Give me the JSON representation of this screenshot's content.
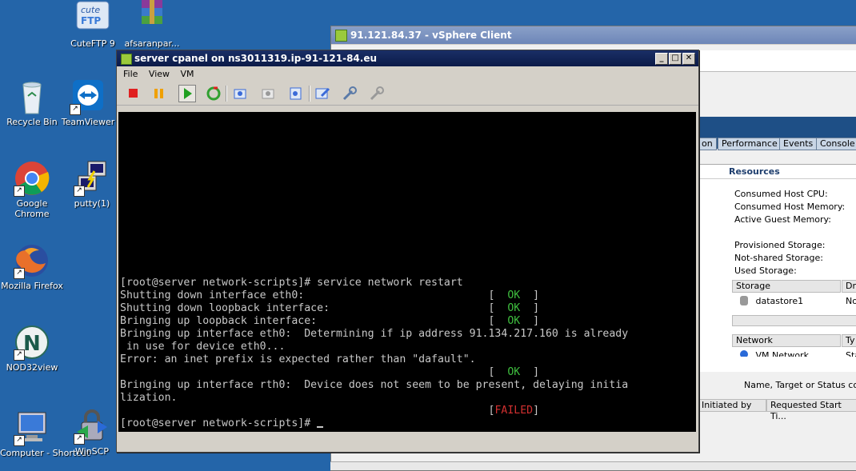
{
  "desktop": {
    "icons": [
      {
        "label": "CuteFTP 9",
        "icon": "cuteftp-icon"
      },
      {
        "label": "afsaranpar...",
        "icon": "winrar-archive-icon"
      },
      {
        "label": "Recycle Bin",
        "icon": "recycle-bin-icon"
      },
      {
        "label": "TeamViewer",
        "icon": "teamviewer-icon"
      },
      {
        "label": "Google Chrome",
        "icon": "chrome-icon"
      },
      {
        "label": "putty(1)",
        "icon": "putty-icon"
      },
      {
        "label": "Mozilla Firefox",
        "icon": "firefox-icon"
      },
      {
        "label": "NOD32view",
        "icon": "nod32-icon"
      },
      {
        "label": "Computer - Shortcut",
        "icon": "computer-icon"
      },
      {
        "label": "WinSCP",
        "icon": "winscp-icon"
      }
    ]
  },
  "vsphere": {
    "title": "91.121.84.37 - vSphere Client",
    "tabs": [
      "on",
      "Performance",
      "Events",
      "Console"
    ],
    "resources_title": "Resources",
    "resource_labels": [
      "Consumed Host CPU:",
      "Consumed Host Memory:",
      "Active Guest Memory:",
      "Provisioned Storage:",
      "Not-shared Storage:",
      "Used Storage:"
    ],
    "storage_header": "Storage",
    "storage_col2": "Dri",
    "datastore": "datastore1",
    "datastore_col2": "No",
    "network_header": "Network",
    "network_col2": "Ty",
    "network_item": "VM Network",
    "network_item_col2": "Sta",
    "tasks_filter_label": "Name, Target or Status conta",
    "tasks_columns": [
      "Initiated by",
      "Requested Start Ti..."
    ]
  },
  "console_window": {
    "title": "server cpanel on ns3011319.ip-91-121-84.eu",
    "menu": [
      "File",
      "View",
      "VM"
    ],
    "toolbar": [
      "power-off-icon",
      "suspend-icon",
      "power-on-icon",
      "reset-icon",
      "snapshot-icon",
      "revert-snapshot-icon",
      "snapshot-manager-icon",
      "edit-settings-icon",
      "tools-icon",
      "connect-devices-icon"
    ],
    "terminal": [
      {
        "text": "[root@server network-scripts]# service network restart"
      },
      {
        "text": "Shutting down interface eth0:                             ",
        "status": "OK"
      },
      {
        "text": "Shutting down loopback interface:                         ",
        "status": "OK"
      },
      {
        "text": "Bringing up loopback interface:                           ",
        "status": "OK"
      },
      {
        "text": "Bringing up interface eth0:  Determining if ip address 91.134.217.160 is already"
      },
      {
        "text": " in use for device eth0..."
      },
      {
        "text": "Error: an inet prefix is expected rather than \"dafault\"."
      },
      {
        "text": "                                                          ",
        "status": "OK"
      },
      {
        "text": "Bringing up interface rth0:  Device does not seem to be present, delaying initia"
      },
      {
        "text": "lization."
      },
      {
        "text": "                                                          ",
        "status": "FAILED"
      },
      {
        "text": "[root@server network-scripts]# ",
        "cursor": true
      }
    ]
  }
}
